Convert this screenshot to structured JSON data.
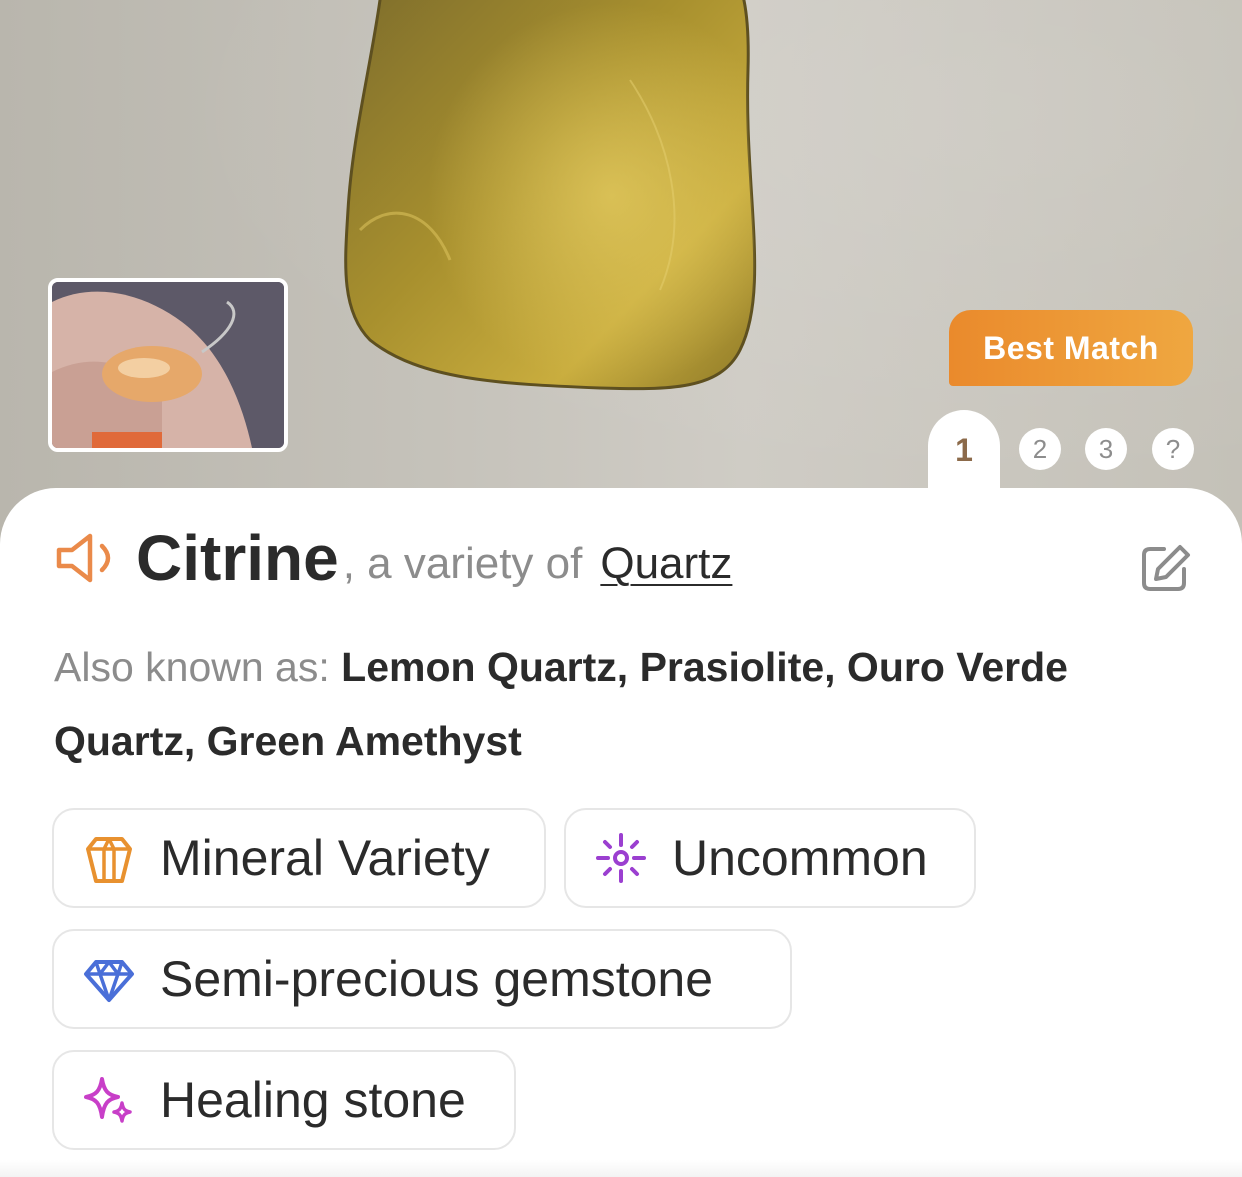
{
  "header": {
    "best_match_label": "Best Match",
    "tabs": [
      {
        "label": "1",
        "active": true
      },
      {
        "label": "2",
        "active": false
      },
      {
        "label": "3",
        "active": false
      },
      {
        "label": "?",
        "active": false
      }
    ]
  },
  "result": {
    "name": "Citrine",
    "variety_text": ", a variety of",
    "parent_link": "Quartz",
    "aka_label": "Also known as:",
    "aka_values": "Lemon Quartz, Prasiolite, Ouro Verde Quartz, Green Amethyst"
  },
  "tags": [
    {
      "label": "Mineral Variety",
      "icon": "crystal-icon",
      "color": "#e8912f"
    },
    {
      "label": "Uncommon",
      "icon": "sparkle-burst-icon",
      "color": "#9b3fd0"
    },
    {
      "label": "Semi-precious gemstone",
      "icon": "diamond-icon",
      "color": "#4a6fd8"
    },
    {
      "label": "Healing stone",
      "icon": "sparkles-icon",
      "color": "#c83fc8"
    }
  ],
  "colors": {
    "accent": "#ea8a2c",
    "speaker": "#ea8a4a",
    "text": "#2b2b2b",
    "muted": "#8c8c8c"
  }
}
